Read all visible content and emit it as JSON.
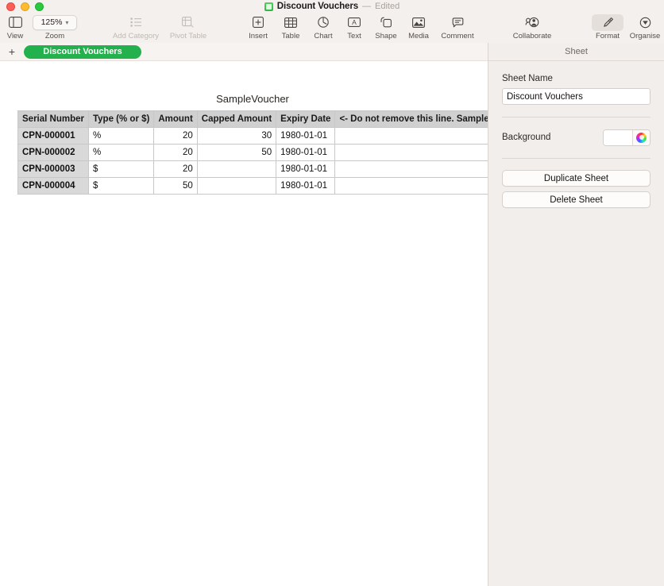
{
  "window": {
    "doc_title": "Discount Vouchers",
    "dash": "—",
    "edited_status": "Edited",
    "doc_icon": "numbers-document-icon"
  },
  "toolbar": {
    "items": [
      {
        "label": "View",
        "icon": "sidebar-view-icon",
        "disabled": false,
        "active": false
      },
      {
        "label": "Zoom",
        "icon": "zoom-popup-icon",
        "disabled": false,
        "active": false
      },
      {
        "label": "Add Category",
        "icon": "list-bullet-icon",
        "disabled": true,
        "active": false
      },
      {
        "label": "Pivot Table",
        "icon": "pivot-table-icon",
        "disabled": true,
        "active": false
      },
      {
        "label": "Insert",
        "icon": "insert-plus-icon",
        "disabled": false,
        "active": false
      },
      {
        "label": "Table",
        "icon": "table-grid-icon",
        "disabled": false,
        "active": false
      },
      {
        "label": "Chart",
        "icon": "chart-pie-icon",
        "disabled": false,
        "active": false
      },
      {
        "label": "Text",
        "icon": "text-box-a-icon",
        "disabled": false,
        "active": false
      },
      {
        "label": "Shape",
        "icon": "shape-icon",
        "disabled": false,
        "active": false
      },
      {
        "label": "Media",
        "icon": "media-photo-icon",
        "disabled": false,
        "active": false
      },
      {
        "label": "Comment",
        "icon": "comment-bubble-icon",
        "disabled": false,
        "active": false
      },
      {
        "label": "Collaborate",
        "icon": "collaborate-icon",
        "disabled": false,
        "active": false
      },
      {
        "label": "Format",
        "icon": "format-brush-icon",
        "disabled": false,
        "active": true
      },
      {
        "label": "Organise",
        "icon": "organise-icon",
        "disabled": false,
        "active": false
      }
    ],
    "zoom_value": "125%"
  },
  "tabbar": {
    "add_sheet_icon": "plus-icon",
    "tabs": [
      {
        "label": "Discount Vouchers",
        "selected": true
      }
    ]
  },
  "canvas": {
    "table_title": "SampleVoucher"
  },
  "table": {
    "headers": [
      "Serial Number",
      "Type (% or $)",
      "Amount",
      "Capped Amount",
      "Expiry Date",
      "<- Do not remove this line. Sample data should"
    ],
    "rows": [
      {
        "serial": "CPN-000001",
        "type": "%",
        "amount": "20",
        "capped": "30",
        "expiry": "1980-01-01",
        "note": ""
      },
      {
        "serial": "CPN-000002",
        "type": "%",
        "amount": "20",
        "capped": "50",
        "expiry": "1980-01-01",
        "note": ""
      },
      {
        "serial": "CPN-000003",
        "type": "$",
        "amount": "20",
        "capped": "",
        "expiry": "1980-01-01",
        "note": ""
      },
      {
        "serial": "CPN-000004",
        "type": "$",
        "amount": "50",
        "capped": "",
        "expiry": "1980-01-01",
        "note": ""
      }
    ]
  },
  "sidebar": {
    "panel_title": "Sheet",
    "sheet_name_label": "Sheet Name",
    "sheet_name_value": "Discount Vouchers",
    "sheet_name_placeholder": "Sheet Name",
    "background_label": "Background",
    "background_color": "#ffffff",
    "color_wheel_icon": "color-wheel-icon",
    "duplicate_label": "Duplicate Sheet",
    "delete_label": "Delete Sheet"
  },
  "colors": {
    "chrome": "#f4f0ed",
    "sidebar": "#f2eeeb",
    "tab_green": "#22b14c",
    "header_gray": "#d0d0d0"
  }
}
